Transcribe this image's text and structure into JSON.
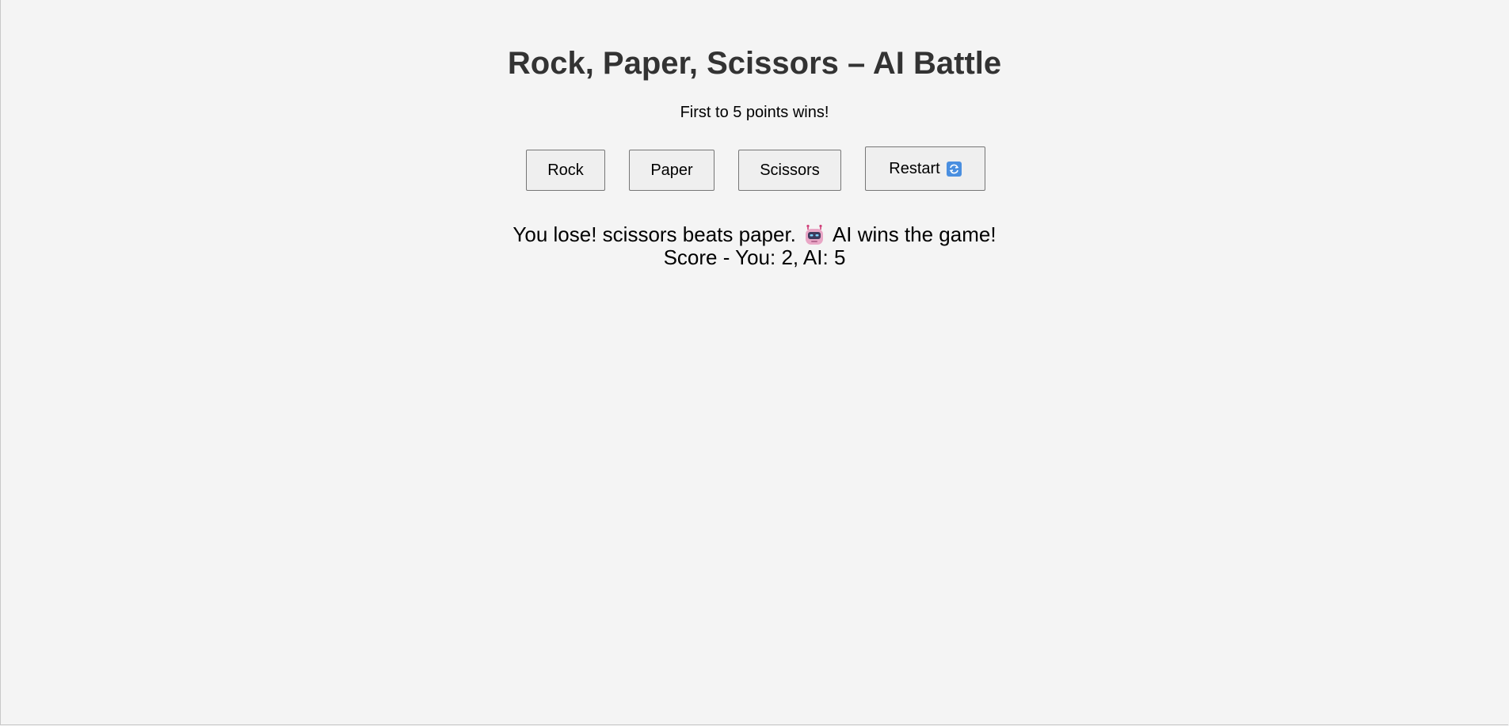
{
  "header": {
    "title": "Rock, Paper, Scissors – AI Battle",
    "subtitle": "First to 5 points wins!"
  },
  "controls": {
    "rock_label": "Rock",
    "paper_label": "Paper",
    "scissors_label": "Scissors",
    "restart_label": "Restart",
    "restart_icon": "refresh-icon"
  },
  "result": {
    "message_before_icon": "You lose! scissors beats paper.",
    "icon": "robot-icon",
    "message_after_icon": "AI wins the game!",
    "score_text": "Score - You: 2, AI: 5"
  },
  "colors": {
    "background": "#f4f4f4",
    "title": "#333333",
    "button_bg": "#efefef",
    "button_border": "#767676"
  }
}
